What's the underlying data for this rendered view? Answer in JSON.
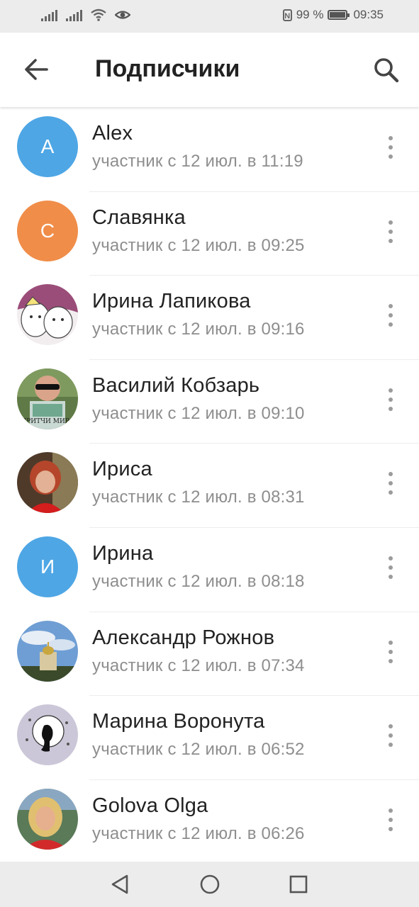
{
  "status_bar": {
    "battery": "99 %",
    "time": "09:35",
    "icons": [
      "signal-icon",
      "signal-icon",
      "wifi-icon",
      "eye-icon",
      "nfc-icon",
      "battery-icon"
    ]
  },
  "header": {
    "title": "Подписчики",
    "back_icon": "arrow-left-icon",
    "search_icon": "search-icon"
  },
  "subscribers": [
    {
      "name": "Alex",
      "joined": "участник с 12 июл. в 11:19",
      "avatar_letter": "A",
      "avatar_color": "#4ea6e5"
    },
    {
      "name": "Славянка",
      "joined": "участник с 12 июл. в 09:25",
      "avatar_letter": "С",
      "avatar_color": "#f08d49"
    },
    {
      "name": "Ирина Лапикова",
      "joined": "участник с 12 июл. в 09:16"
    },
    {
      "name": "Василий Кобзарь",
      "joined": "участник с 12 июл. в 09:10",
      "photo_text": "ПРИТЧИ МИРА"
    },
    {
      "name": "Ириса",
      "joined": "участник с 12 июл. в 08:31"
    },
    {
      "name": "Ирина",
      "joined": "участник с 12 июл. в 08:18",
      "avatar_letter": "И",
      "avatar_color": "#4ea6e5"
    },
    {
      "name": "Александр Рожнов",
      "joined": "участник с 12 июл. в 07:34"
    },
    {
      "name": "Марина Воронута",
      "joined": "участник с 12 июл. в 06:52"
    },
    {
      "name": "Golova Olga",
      "joined": "участник с 12 июл. в 06:26"
    }
  ],
  "nav_bar": {
    "icons": [
      "nav-back-icon",
      "nav-home-icon",
      "nav-recents-icon"
    ]
  },
  "colors": {
    "accent_blue": "#4ea6e5",
    "accent_orange": "#f08d49",
    "secondary_text": "#8e8e8e"
  }
}
